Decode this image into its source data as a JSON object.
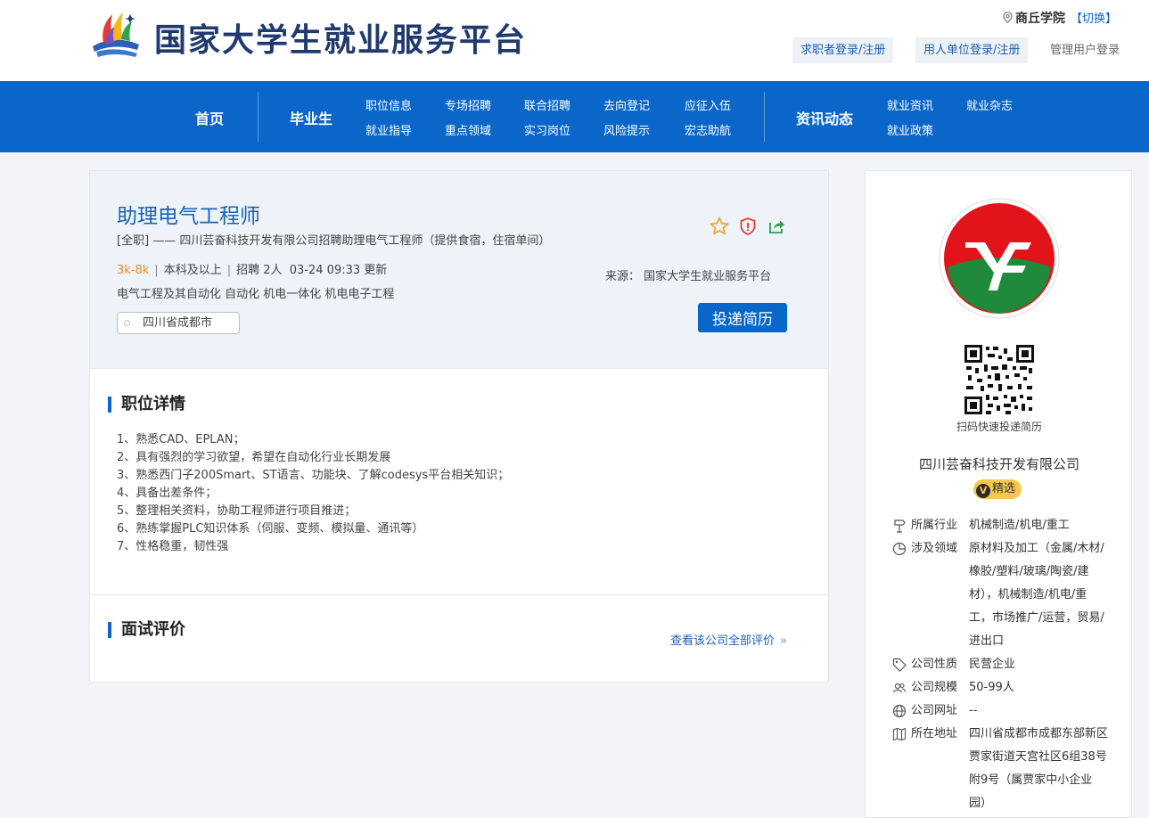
{
  "header": {
    "site_title": "国家大学生就业服务平台",
    "location_name": "商丘学院",
    "switch_label": "【切换】",
    "jobseeker_login": "求职者登录/注册",
    "employer_login": "用人单位登录/注册",
    "admin_login": "管理用户登录"
  },
  "nav": {
    "home": "首页",
    "graduates": "毕业生",
    "job_info": "职位信息",
    "special_recruit": "专场招聘",
    "joint_recruit": "联合招聘",
    "destination_register": "去向登记",
    "enlist": "应征入伍",
    "career_guide": "就业指导",
    "key_fields": "重点领域",
    "internship": "实习岗位",
    "risk_alert": "风险提示",
    "hongzhi": "宏志助航",
    "news": "资讯动态",
    "employment_news": "就业资讯",
    "employment_magazine": "就业杂志",
    "employment_policy": "就业政策"
  },
  "job": {
    "title": "助理电气工程师",
    "subtitle": "[全职]   ——   四川芸奋科技开发有限公司招聘助理电气工程师（提供食宿，住宿单间）",
    "salary": "3k-8k",
    "education": "本科及以上",
    "headcount": "招聘 2人",
    "updated": "03-24 09:33 更新",
    "majors": "电气工程及其自动化 自动化 机电一体化 机电电子工程",
    "location": "四川省成都市",
    "source": "来源： 国家大学生就业服务平台",
    "apply_label": "投递简历"
  },
  "detail": {
    "title": "职位详情",
    "items": [
      "1、熟悉CAD、EPLAN；",
      "2、具有强烈的学习欲望，希望在自动化行业长期发展",
      "3、熟悉西门子200Smart、ST语言、功能块、了解codesys平台相关知识；",
      "4、具备出差条件；",
      "5、整理相关资料，协助工程师进行项目推进；",
      "6、熟练掌握PLC知识体系（伺服、变频、模拟量、通讯等）",
      "7、性格稳重，韧性强"
    ]
  },
  "interview": {
    "title": "面试评价",
    "all_reviews_label": "查看该公司全部评价"
  },
  "company": {
    "qr_caption": "扫码快速投递简历",
    "name": "四川芸奋科技开发有限公司",
    "badge_label": "精选",
    "badge_letter": "V",
    "info": [
      {
        "label": "所属行业",
        "value": "机械制造/机电/重工"
      },
      {
        "label": "涉及领域",
        "value": "原材料及加工（金属/木材/橡胶/塑料/玻璃/陶瓷/建材），机械制造/机电/重工，市场推广/运营，贸易/进出口"
      },
      {
        "label": "公司性质",
        "value": "民营企业"
      },
      {
        "label": "公司规模",
        "value": "50-99人"
      },
      {
        "label": "公司网址",
        "value": "--"
      },
      {
        "label": "所在地址",
        "value": "四川省成都市成都东部新区贾家街道天宫社区6组38号附9号（属贾家中小企业园）"
      }
    ]
  },
  "colors": {
    "primary": "#0a66c8",
    "salary": "#f08a24",
    "title": "#1a62b6",
    "badge": "#f5c84c"
  }
}
